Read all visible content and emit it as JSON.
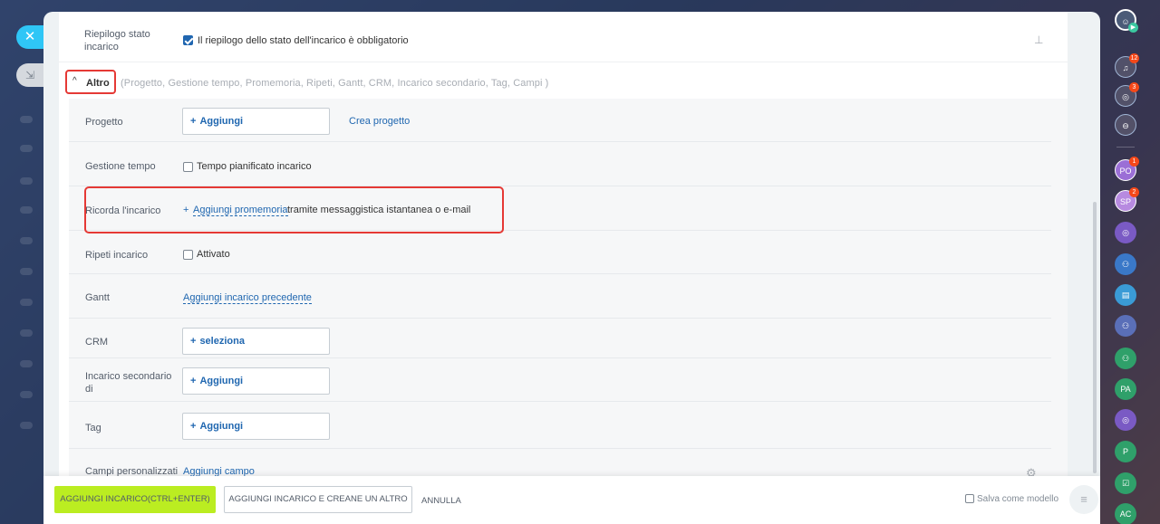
{
  "summary": {
    "label": "Riepilogo stato incarico",
    "checkbox_text": "Il riepilogo dello stato dell'incarico è obbligatorio",
    "checked": true
  },
  "altro": {
    "label": "Altro",
    "sections_list": "(Progetto,  Gestione tempo,  Promemoria,  Ripeti,  Gantt,  CRM,  Incarico secondario,  Tag,  Campi )"
  },
  "fields": {
    "progetto": {
      "label": "Progetto",
      "button": "Aggiungi",
      "link": "Crea progetto"
    },
    "gestione_tempo": {
      "label": "Gestione tempo",
      "checkbox_text": "Tempo pianificato incarico"
    },
    "ricorda": {
      "label": "Ricorda l'incarico",
      "plus": "+",
      "link": "Aggiungi promemoria",
      "suffix": "tramite messaggistica istantanea o e-mail"
    },
    "ripeti": {
      "label": "Ripeti incarico",
      "checkbox_text": "Attivato"
    },
    "gantt": {
      "label": "Gantt",
      "link": "Aggiungi incarico precedente"
    },
    "crm": {
      "label": "CRM",
      "button": "seleziona"
    },
    "secondario": {
      "label": "Incarico secondario di",
      "button": "Aggiungi"
    },
    "tag": {
      "label": "Tag",
      "button": "Aggiungi"
    },
    "campi": {
      "label": "Campi personalizzati",
      "link": "Aggiungi campo"
    }
  },
  "footer": {
    "primary": "AGGIUNGI INCARICO(CTRL+ENTER)",
    "secondary": "AGGIUNGI INCARICO E CREANE UN ALTRO",
    "cancel": "ANNULLA",
    "save_template": "Salva come modello"
  },
  "right_bar": {
    "notifications_count": "12",
    "activity_count": "3",
    "avatars": [
      {
        "initials": "PO",
        "badge": "1",
        "color": "#9b6fd6"
      },
      {
        "initials": "SP",
        "badge": "2",
        "color": "#b78ae0"
      },
      {
        "initials": "PA",
        "badge": "",
        "color": "#2fa06a"
      },
      {
        "initials": "P",
        "badge": "",
        "color": "#2fa06a"
      },
      {
        "initials": "AC",
        "badge": "",
        "color": "#2fa06a"
      }
    ]
  },
  "colors": {
    "primary_button": "#bbed21",
    "link": "#2067b0",
    "highlight": "#e53935",
    "close_button": "#2fc6f6"
  }
}
